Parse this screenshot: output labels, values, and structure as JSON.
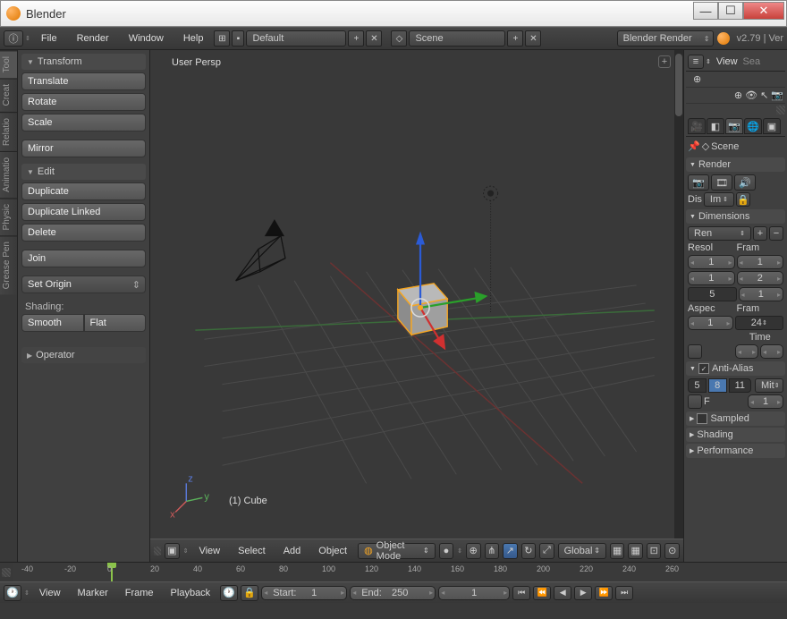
{
  "titlebar": {
    "title": "Blender"
  },
  "topmenu": {
    "info_icon": "ⓘ",
    "file": "File",
    "render": "Render",
    "window": "Window",
    "help": "Help",
    "layout_dd": "Default",
    "scene_dd": "Scene",
    "engine_dd": "Blender Render",
    "version": "v2.79 | Ver"
  },
  "toolshelf": {
    "tabs": [
      "Tool",
      "Creat",
      "Relatio",
      "Animatio",
      "Physic",
      "Grease Pen"
    ],
    "transform_h": "Transform",
    "translate": "Translate",
    "rotate": "Rotate",
    "scale": "Scale",
    "mirror": "Mirror",
    "edit_h": "Edit",
    "duplicate": "Duplicate",
    "duplicate_linked": "Duplicate Linked",
    "delete": "Delete",
    "join": "Join",
    "set_origin": "Set Origin",
    "shading_label": "Shading:",
    "smooth": "Smooth",
    "flat": "Flat",
    "operator_h": "Operator"
  },
  "viewport": {
    "persp_label": "User Persp",
    "object_label": "(1) Cube",
    "header": {
      "view": "View",
      "select": "Select",
      "add": "Add",
      "object": "Object",
      "mode": "Object Mode",
      "orientation": "Global"
    }
  },
  "properties": {
    "view_btn": "View",
    "search": "Sea",
    "scene_crumb": "Scene",
    "render_h": "Render",
    "display": "Dis",
    "display_mode": "Im",
    "dimensions_h": "Dimensions",
    "preset": "Ren",
    "resol_label": "Resol",
    "frame_label": "Fram",
    "res_x": "1",
    "res_y": "1",
    "res_pct": "5",
    "fr_start": "1",
    "fr_end": "2",
    "fr_step": "1",
    "aspect_label": "Aspec",
    "framerate_label": "Fram",
    "aspect_x": "1",
    "fps": "24",
    "time_label": "Time",
    "aa_h": "Anti-Alias",
    "aa_5": "5",
    "aa_8": "8",
    "aa_11": "11",
    "aa_mit": "Mit",
    "aa_f": "F",
    "aa_size": "1",
    "sampled_h": "Sampled",
    "shading_h": "Shading",
    "perf_h": "Performance"
  },
  "timeline": {
    "ticks": [
      "-40",
      "-20",
      "0",
      "20",
      "40",
      "60",
      "80",
      "100",
      "120",
      "140",
      "160",
      "180",
      "200",
      "220",
      "240",
      "260"
    ],
    "view": "View",
    "marker": "Marker",
    "frame": "Frame",
    "playback": "Playback",
    "start_label": "Start:",
    "start_val": "1",
    "end_label": "End:",
    "end_val": "250",
    "current": "1"
  }
}
